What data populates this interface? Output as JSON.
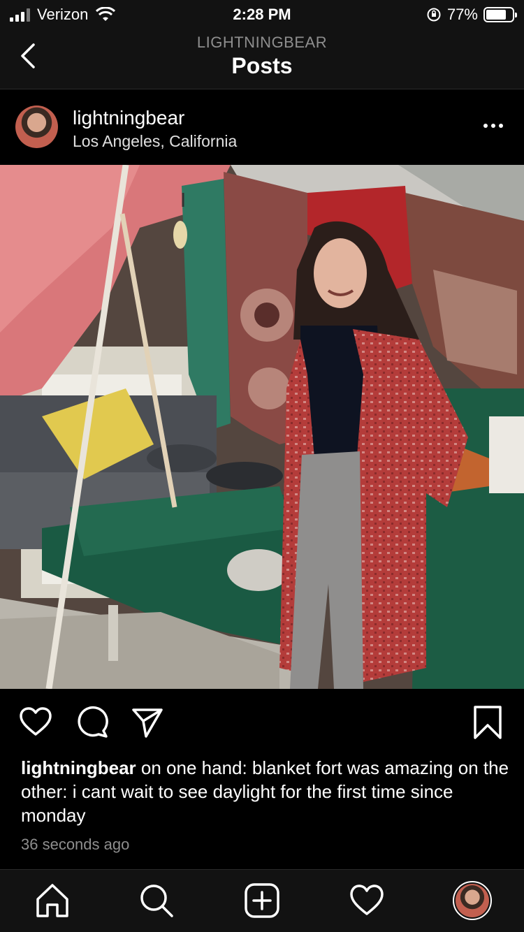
{
  "status": {
    "carrier": "Verizon",
    "time": "2:28 PM",
    "battery_text": "77%",
    "battery_level": 0.77
  },
  "header": {
    "subtitle": "LIGHTNINGBEAR",
    "title": "Posts"
  },
  "post": {
    "username": "lightningbear",
    "location": "Los Angeles, California",
    "caption_user": "lightningbear",
    "caption_text": " on one hand: blanket fort was amazing on the other: i cant wait to see daylight for the first time since monday",
    "time_ago": "36 seconds ago"
  },
  "icons": {
    "back": "chevron-left-icon",
    "more": "ellipsis-icon",
    "like": "heart-icon",
    "comment": "comment-icon",
    "share": "paper-plane-icon",
    "save": "bookmark-icon",
    "home": "home-icon",
    "search": "search-icon",
    "add": "plus-square-icon",
    "activity": "heart-icon",
    "profile": "avatar"
  }
}
